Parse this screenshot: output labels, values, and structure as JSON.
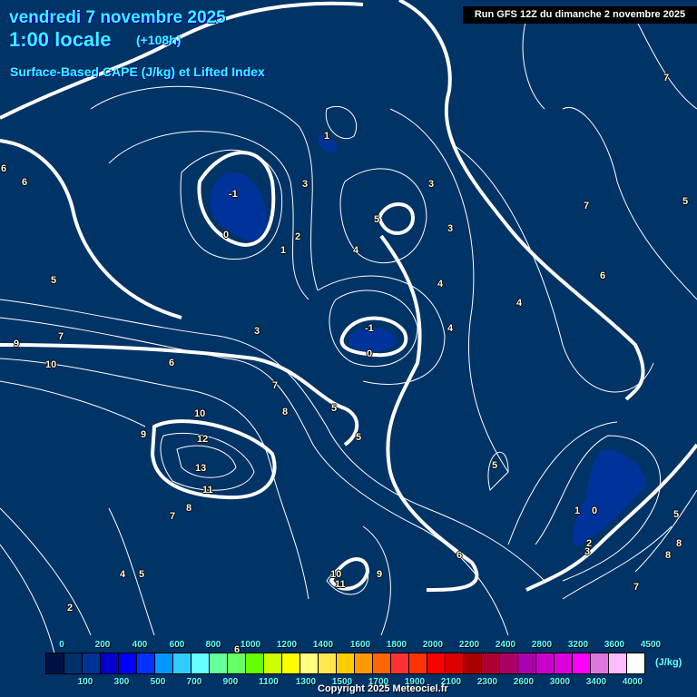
{
  "header": {
    "date": "vendredi 7 novembre 2025",
    "hour": "1:00 locale",
    "lead": "(+108h)",
    "parameter": "Surface-Based CAPE (J/kg) et Lifted Index",
    "run": "Run GFS 12Z du dimanche 2 novembre 2025"
  },
  "colors": {
    "background": "#003366",
    "contour": "#ffffff",
    "title": "#33ffff"
  },
  "contour_labels": [
    "-1",
    "0",
    "-1",
    "0",
    "5",
    "1",
    "3",
    "2",
    "1",
    "3",
    "3",
    "4",
    "4",
    "4",
    "4",
    "5",
    "7",
    "6",
    "7",
    "6",
    "6",
    "5",
    "5",
    "9",
    "7",
    "10",
    "6",
    "7",
    "3",
    "8",
    "5",
    "5",
    "10",
    "12",
    "13",
    "9",
    "11",
    "8",
    "7",
    "4",
    "5",
    "2",
    "10",
    "11",
    "9",
    "6",
    "1",
    "0",
    "2",
    "3",
    "8",
    "8",
    "7",
    "5",
    "6"
  ],
  "legend": {
    "unit": "(J/kg)",
    "colors": [
      "#001040",
      "#00306a",
      "#003399",
      "#0000cc",
      "#0000ff",
      "#0033ff",
      "#0099ff",
      "#33ccff",
      "#66ffff",
      "#66ff99",
      "#66ff66",
      "#66ff00",
      "#ccff00",
      "#ffff00",
      "#ffff80",
      "#ffe650",
      "#ffcc00",
      "#ff9900",
      "#ff6600",
      "#ff3333",
      "#ff3300",
      "#ff0000",
      "#dd0000",
      "#aa0000",
      "#aa0033",
      "#aa0066",
      "#aa00aa",
      "#cc00cc",
      "#dd00dd",
      "#ff00ff",
      "#dd77dd",
      "#ffbbff",
      "#ffffff"
    ],
    "top_ticks": [
      "0",
      "200",
      "400",
      "600",
      "800",
      "1000",
      "1200",
      "1400",
      "1600",
      "1800",
      "2000",
      "2200",
      "2400",
      "2800",
      "3200",
      "3600",
      "4500"
    ],
    "bottom_ticks": [
      "100",
      "300",
      "500",
      "700",
      "900",
      "1100",
      "1300",
      "1500",
      "1700",
      "1900",
      "2100",
      "2300",
      "2600",
      "3000",
      "3400",
      "4000"
    ]
  },
  "copyright": "Copyright 2025 Meteociel.fr"
}
